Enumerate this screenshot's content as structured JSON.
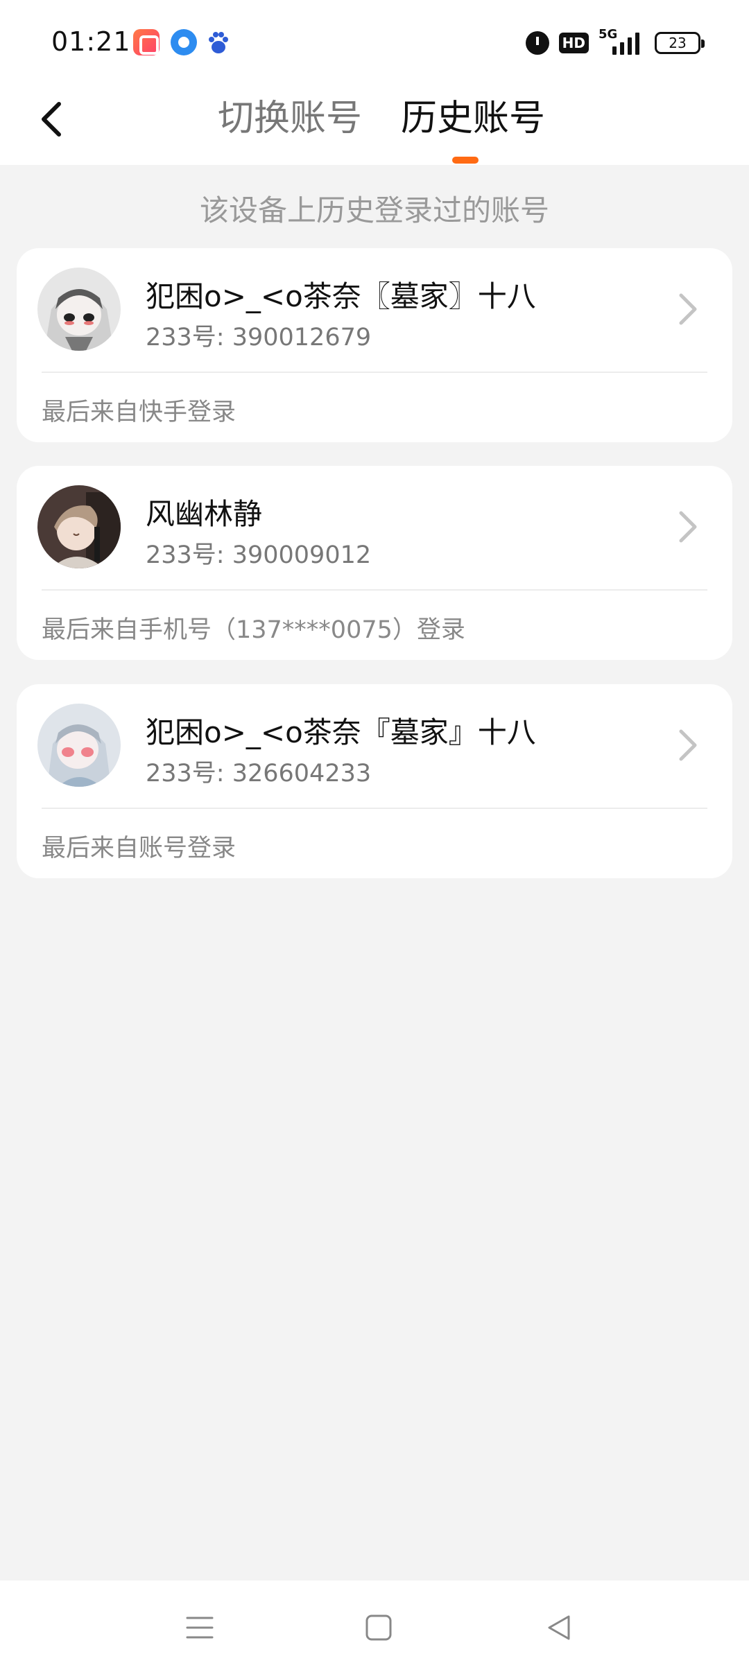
{
  "status_bar": {
    "time": "01:21",
    "network": "5G",
    "hd": "HD",
    "battery": "23"
  },
  "header": {
    "tabs": [
      {
        "label": "切换账号",
        "active": false
      },
      {
        "label": "历史账号",
        "active": true
      }
    ],
    "accent_color": "#ff6a13"
  },
  "subtitle": "该设备上历史登录过的账号",
  "accounts": [
    {
      "name": "犯困o>_<o茶奈〖墓家〗十八",
      "id_text": "233号: 390012679",
      "login_source": "最后来自快手登录"
    },
    {
      "name": "风幽林静",
      "id_text": "233号: 390009012",
      "login_source": "最后来自手机号（137****0075）登录"
    },
    {
      "name": "犯困o>_<o茶奈『墓家』十八",
      "id_text": "233号: 326604233",
      "login_source": "最后来自账号登录"
    }
  ],
  "icons": {
    "back": "chevron-left-icon",
    "row": "chevron-right-icon",
    "nav": [
      "menu-icon",
      "home-square-icon",
      "back-triangle-icon"
    ]
  }
}
